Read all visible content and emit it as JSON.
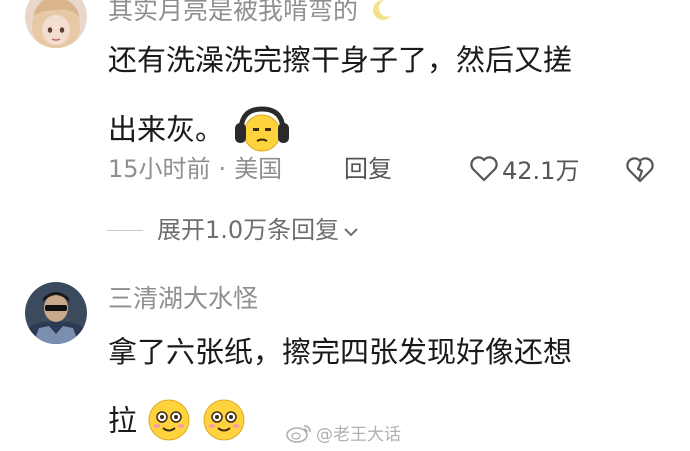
{
  "comment1": {
    "username": "其实月亮是被我啃弯的",
    "line1": "还有洗澡洗完擦干身子了，然后又搓",
    "line2": "出来灰。",
    "time": "15小时前",
    "location": "美国",
    "reply_label": "回复",
    "like_count": "42.1万",
    "expand_label": "展开1.0万条回复"
  },
  "comment2": {
    "username": "三清湖大水怪",
    "line1": "拿了六张纸，擦完四张发现好像还想",
    "line2": "拉"
  },
  "watermark": {
    "text": "@老王大话"
  },
  "icons": {
    "moon": "crescent-moon-icon",
    "headphone_emoji": "headphone-face-emoji",
    "smile_emoji": "smile-face-emoji",
    "like": "heart-outline-icon",
    "dislike": "broken-heart-icon",
    "chevron": "chevron-down-icon",
    "weibo": "weibo-logo-icon"
  },
  "colors": {
    "username": "#8f8f8f",
    "body": "#1a1a1a",
    "meta": "#8f8f8f",
    "emoji_yellow": "#ffd33d"
  }
}
